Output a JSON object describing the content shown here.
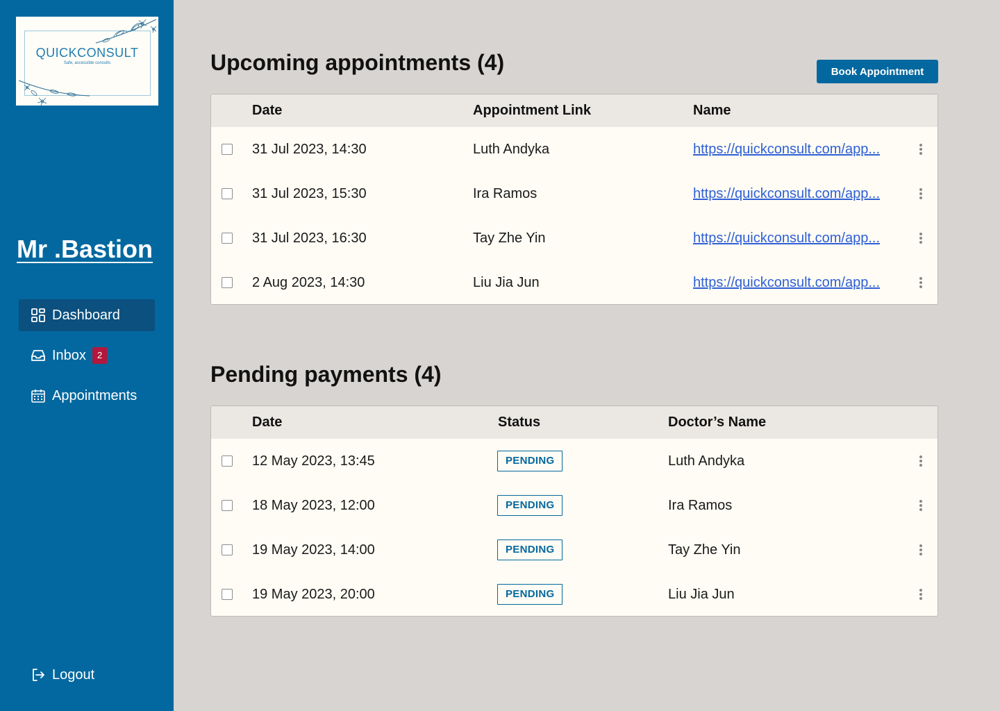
{
  "logo": {
    "brand": "QUICKCONSULT",
    "tagline": "Safe, accessible consults"
  },
  "user": {
    "name": "Mr .Bastion"
  },
  "nav": {
    "dashboard": {
      "label": "Dashboard",
      "icon": "dashboard-icon",
      "active": true
    },
    "inbox": {
      "label": "Inbox",
      "icon": "inbox-icon",
      "badge": "2"
    },
    "appointments": {
      "label": "Appointments",
      "icon": "calendar-icon"
    },
    "logout": {
      "label": "Logout",
      "icon": "logout-icon"
    }
  },
  "upcoming": {
    "title": "Upcoming appointments (4)",
    "book_label": "Book Appointment",
    "headers": {
      "date": "Date",
      "link": "Appointment Link",
      "name": "Name"
    },
    "rows": [
      {
        "date": "31 Jul 2023, 14:30",
        "person": "Luth Andyka",
        "url": "https://quickconsult.com/app..."
      },
      {
        "date": "31 Jul 2023, 15:30",
        "person": "Ira Ramos",
        "url": "https://quickconsult.com/app..."
      },
      {
        "date": "31 Jul 2023, 16:30",
        "person": "Tay Zhe Yin",
        "url": "https://quickconsult.com/app..."
      },
      {
        "date": "2 Aug 2023, 14:30",
        "person": "Liu Jia Jun",
        "url": "https://quickconsult.com/app..."
      }
    ]
  },
  "payments": {
    "title": "Pending payments (4)",
    "headers": {
      "date": "Date",
      "status": "Status",
      "doctor": "Doctor’s Name"
    },
    "rows": [
      {
        "date": "12 May 2023, 13:45",
        "status": "PENDING",
        "doctor": "Luth Andyka"
      },
      {
        "date": "18 May 2023, 12:00",
        "status": "PENDING",
        "doctor": "Ira Ramos"
      },
      {
        "date": "19 May 2023, 14:00",
        "status": "PENDING",
        "doctor": "Tay Zhe Yin"
      },
      {
        "date": "19 May 2023, 20:00",
        "status": "PENDING",
        "doctor": "Liu Jia Jun"
      }
    ]
  },
  "colors": {
    "sidebar": "#03689f",
    "nav_active": "#0b507f",
    "background": "#d8d4d1",
    "badge": "#b3173b",
    "link": "#2f5fd6",
    "table_header": "#ebe8e3",
    "table_body": "#fefcf4"
  }
}
